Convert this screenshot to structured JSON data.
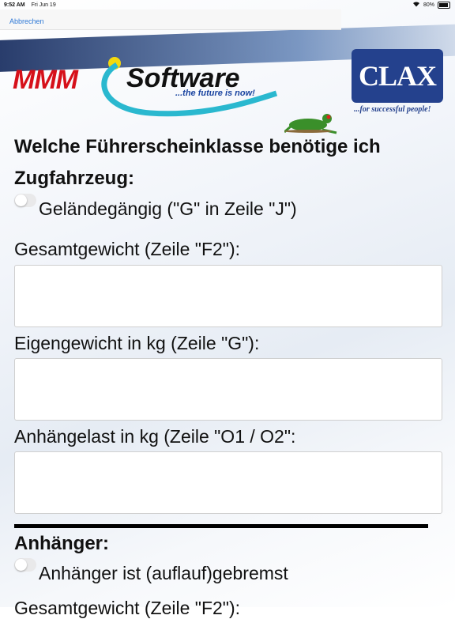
{
  "status_bar": {
    "time": "9:52 AM",
    "date": "Fri Jun 19",
    "battery": "80%"
  },
  "navbar": {
    "cancel_label": "Abbrechen"
  },
  "banner": {
    "mmm": "MMM",
    "software": "Software",
    "tagline": "...the future is now!",
    "clax_logo": "CLAX",
    "clax_tagline": "...for successful people!"
  },
  "form": {
    "question": "Welche Führerscheinklasse benötige ich",
    "section_zugfahrzeug": "Zugfahrzeug:",
    "gelaendegaengig_label": "Geländegängig (\"G\" in Zeile \"J\")",
    "gelaendegaengig_checked": false,
    "gesamtgewicht_label": "Gesamtgewicht (Zeile \"F2\"):",
    "gesamtgewicht_value": "",
    "eigengewicht_label": "Eigengewicht in kg (Zeile \"G\"):",
    "eigengewicht_value": "",
    "anhaengelast_label": "Anhängelast in kg (Zeile \"O1 / O2\":",
    "anhaengelast_value": "",
    "section_anhaenger": "Anhänger:",
    "gebremst_label": "Anhänger ist (auflauf)gebremst",
    "gebremst_checked": false,
    "next_label_partial": "Gesamtgewicht (Zeile \"F2\"):"
  }
}
